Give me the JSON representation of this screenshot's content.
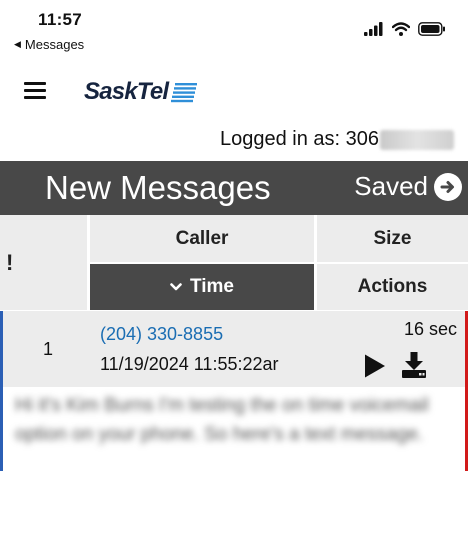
{
  "status_bar": {
    "time": "11:57",
    "back_label": "Messages"
  },
  "header": {
    "logo_text": "SaskTel",
    "logged_in_label": "Logged in as: 306"
  },
  "title_bar": {
    "title": "New Messages",
    "saved_label": "Saved"
  },
  "table_headers": {
    "flag": "!",
    "caller": "Caller",
    "size": "Size",
    "time": "Time",
    "actions": "Actions"
  },
  "messages": [
    {
      "number": "1",
      "caller": "(204) 330-8855",
      "date": "11/19/2024 11:55:22ar",
      "size": "16 sec",
      "transcript": "Hi it's Kim Burns I'm testing the on time voicemail option on your phone. So here's a text message."
    }
  ],
  "colors": {
    "dark_bar": "#484848",
    "header_bg": "#ececec",
    "link": "#1a6db3",
    "left_accent": "#2b5fb5",
    "right_accent": "#d11a1a"
  }
}
